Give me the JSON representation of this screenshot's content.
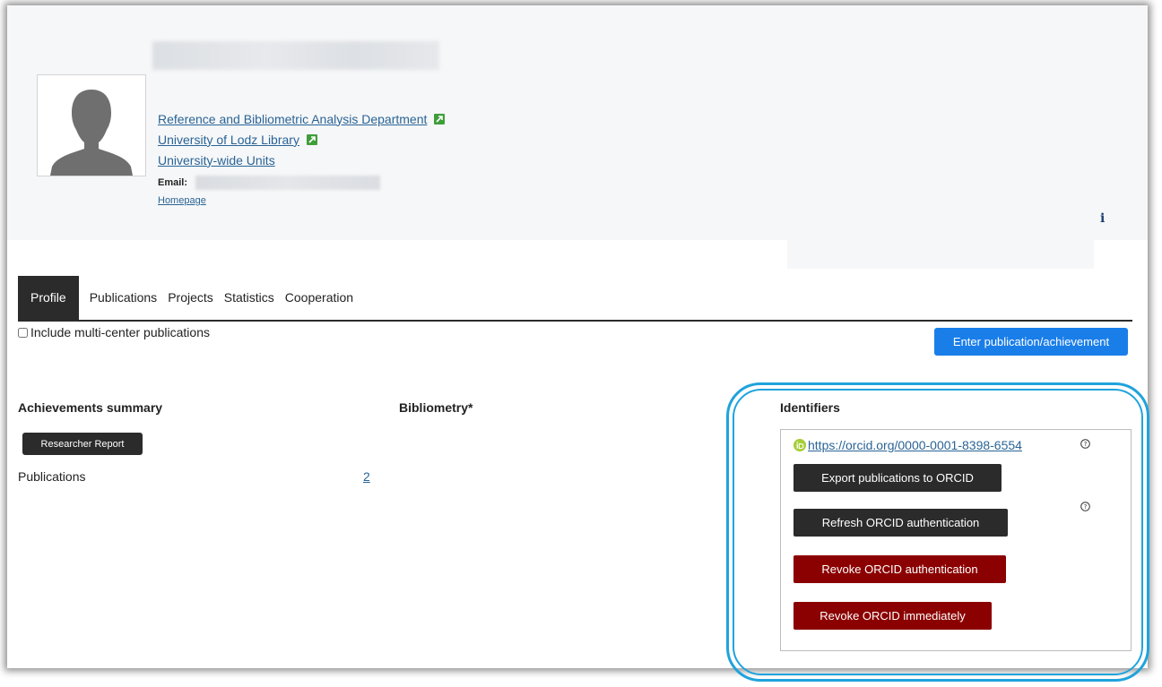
{
  "profile": {
    "units": [
      {
        "label": "Reference and Bibliometric Analysis Department",
        "external": true
      },
      {
        "label": "University of Lodz Library",
        "external": true
      },
      {
        "label": "University-wide Units",
        "external": false
      }
    ],
    "email_label": "Email:",
    "homepage_label": "Homepage",
    "info_icon": "i"
  },
  "tabs": [
    "Profile",
    "Publications",
    "Projects",
    "Statistics",
    "Cooperation"
  ],
  "active_tab": "Profile",
  "options": {
    "multi_center_label": "Include multi-center publications",
    "multi_center_checked": false
  },
  "actions": {
    "enter_publication": "Enter publication/achievement"
  },
  "achievements": {
    "title": "Achievements summary",
    "report_button": "Researcher Report",
    "publications_label": "Publications",
    "publications_count": "2"
  },
  "bibliometry": {
    "title": "Bibliometry*"
  },
  "identifiers": {
    "title": "Identifiers",
    "orcid_url": "https://orcid.org/0000-0001-8398-6554",
    "help_glyph": "?",
    "export_button": "Export publications to ORCID",
    "refresh_button": "Refresh ORCID authentication",
    "revoke_button": "Revoke ORCID authentication",
    "revoke_immediately_button": "Revoke ORCID immediately"
  },
  "colors": {
    "primary_button": "#1a7ee9",
    "dark_button": "#2b2b2b",
    "danger_button": "#8b0000",
    "link": "#2a6496",
    "highlight": "#1fa3dc",
    "orcid_green": "#a6ce39"
  }
}
